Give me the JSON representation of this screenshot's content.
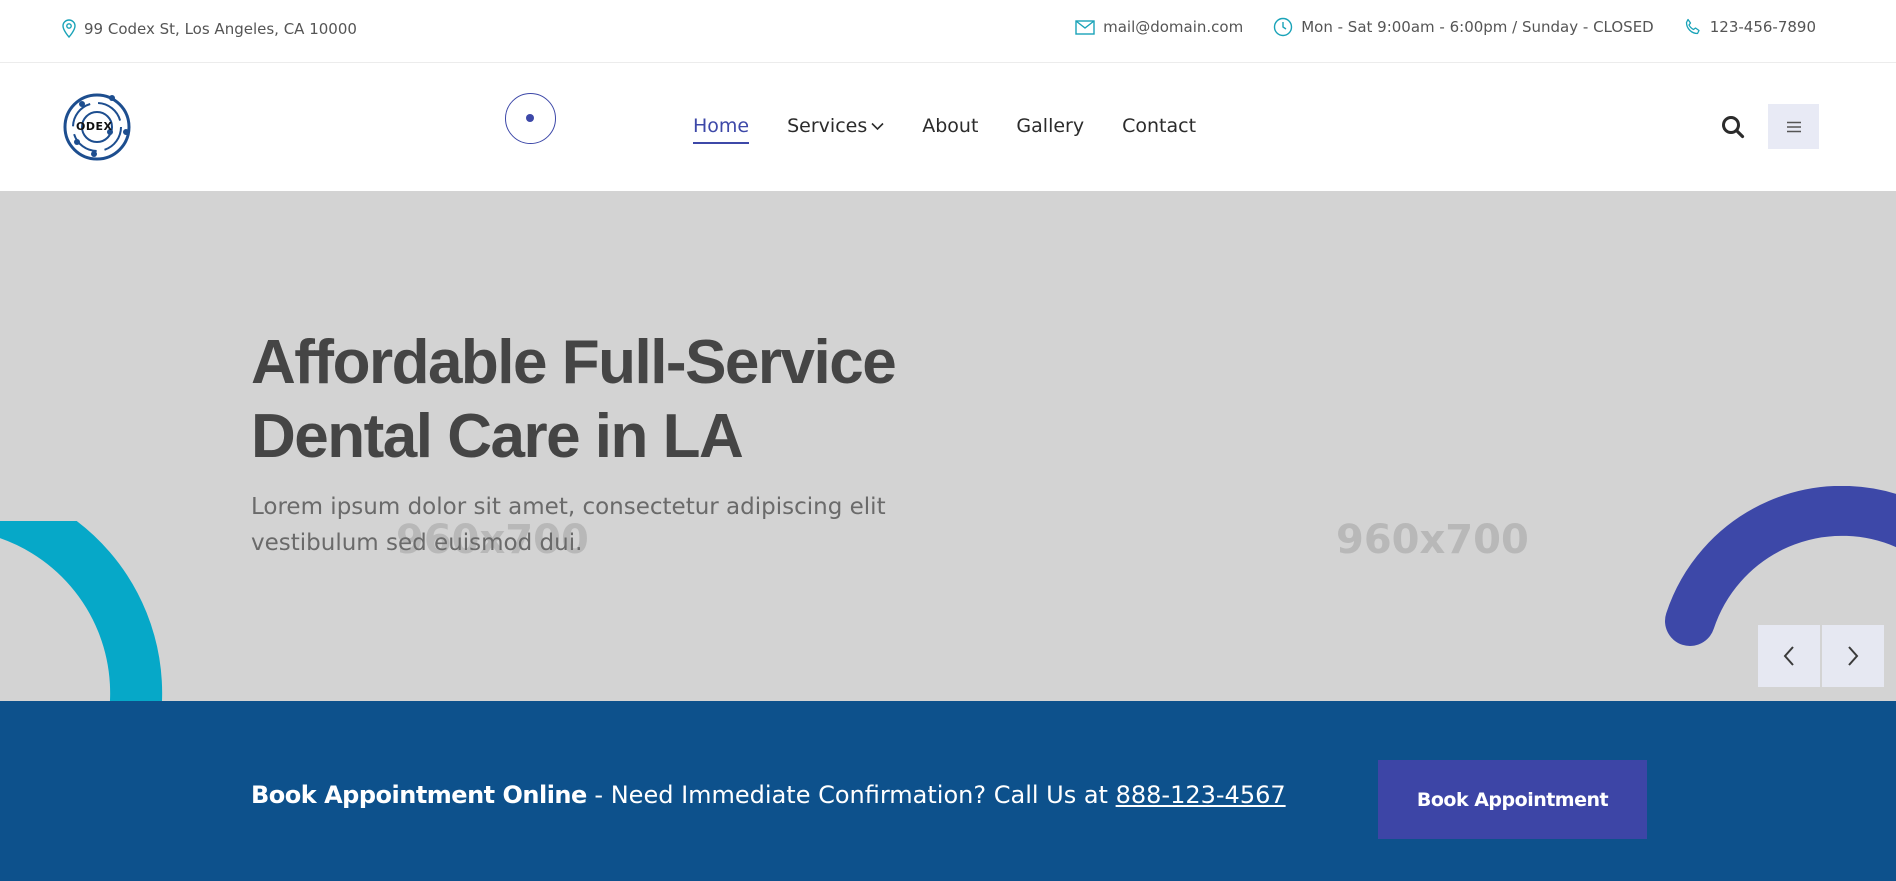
{
  "topbar": {
    "address": "99 Codex St, Los Angeles, CA 10000",
    "email": "mail@domain.com",
    "hours": "Mon - Sat 9:00am - 6:00pm / Sunday - CLOSED",
    "phone": "123-456-7890",
    "icon_color": "#1aa3b8"
  },
  "header": {
    "logo_text": "ODEX",
    "nav": {
      "home": "Home",
      "services": "Services",
      "about": "About",
      "gallery": "Gallery",
      "contact": "Contact"
    },
    "accent_color": "#3d48a8"
  },
  "hero": {
    "title_line1": "Affordable Full-Service",
    "title_line2": "Dental Care in LA",
    "subtitle_line1": "Lorem ipsum dolor sit amet, consectetur adipiscing elit",
    "subtitle_line2": "vestibulum sed euismod dui.",
    "placeholder_left": "960x700",
    "placeholder_right": "960x700",
    "arc_left_color": "#06a8c8",
    "arc_right_color": "#3d48a8"
  },
  "bookbar": {
    "lead": "Book Appointment Online",
    "sep": " - ",
    "text": "Need Immediate Confirmation? Call Us at ",
    "phone": "888-123-4567",
    "button_label": "Book Appointment",
    "bg_color": "#0d518c"
  }
}
